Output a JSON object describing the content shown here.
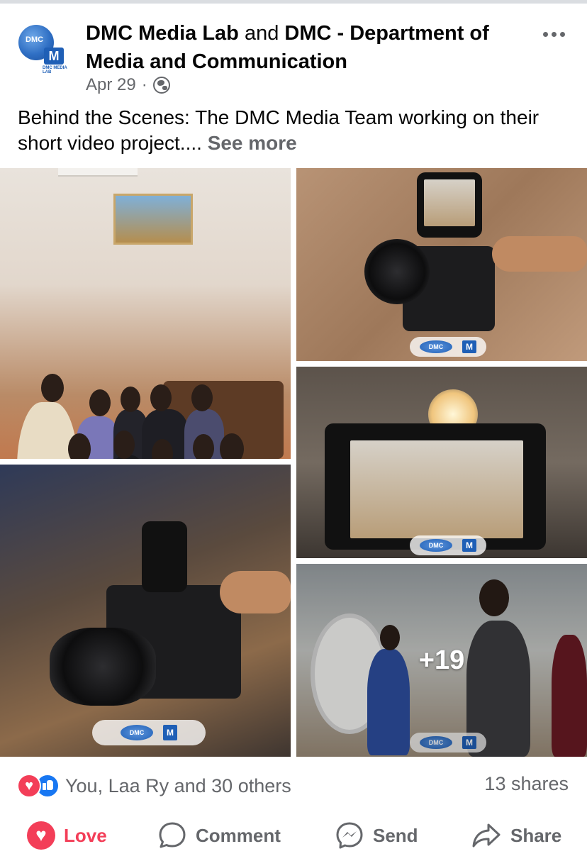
{
  "post": {
    "author_primary": "DMC Media Lab",
    "author_joiner": "and",
    "author_secondary": "DMC - Department of Media and Communication",
    "date": "Apr 29",
    "meta_separator": "·",
    "audience_icon": "globe-icon",
    "caption": "Behind the Scenes: The DMC Media Team working on their short video project....",
    "see_more_label": "See more"
  },
  "photos": {
    "more_count_label": "+19"
  },
  "engagement": {
    "reaction_icons": [
      "love-icon",
      "like-icon"
    ],
    "reaction_summary": "You, Laa Ry and 30 others",
    "shares": "13 shares"
  },
  "actions": {
    "love_label": "Love",
    "comment_label": "Comment",
    "send_label": "Send",
    "share_label": "Share"
  },
  "colors": {
    "love": "#f33e58",
    "like": "#1877f2",
    "secondary_text": "#65676b",
    "primary_text": "#050505"
  }
}
